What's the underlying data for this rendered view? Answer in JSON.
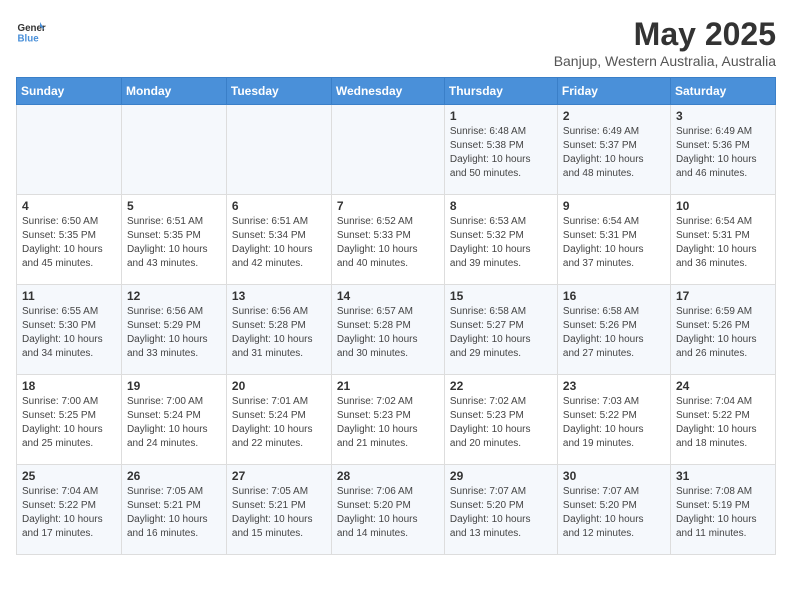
{
  "logo": {
    "line1": "General",
    "line2": "Blue"
  },
  "title": "May 2025",
  "subtitle": "Banjup, Western Australia, Australia",
  "headers": [
    "Sunday",
    "Monday",
    "Tuesday",
    "Wednesday",
    "Thursday",
    "Friday",
    "Saturday"
  ],
  "weeks": [
    [
      {
        "day": "",
        "info": ""
      },
      {
        "day": "",
        "info": ""
      },
      {
        "day": "",
        "info": ""
      },
      {
        "day": "",
        "info": ""
      },
      {
        "day": "1",
        "info": "Sunrise: 6:48 AM\nSunset: 5:38 PM\nDaylight: 10 hours\nand 50 minutes."
      },
      {
        "day": "2",
        "info": "Sunrise: 6:49 AM\nSunset: 5:37 PM\nDaylight: 10 hours\nand 48 minutes."
      },
      {
        "day": "3",
        "info": "Sunrise: 6:49 AM\nSunset: 5:36 PM\nDaylight: 10 hours\nand 46 minutes."
      }
    ],
    [
      {
        "day": "4",
        "info": "Sunrise: 6:50 AM\nSunset: 5:35 PM\nDaylight: 10 hours\nand 45 minutes."
      },
      {
        "day": "5",
        "info": "Sunrise: 6:51 AM\nSunset: 5:35 PM\nDaylight: 10 hours\nand 43 minutes."
      },
      {
        "day": "6",
        "info": "Sunrise: 6:51 AM\nSunset: 5:34 PM\nDaylight: 10 hours\nand 42 minutes."
      },
      {
        "day": "7",
        "info": "Sunrise: 6:52 AM\nSunset: 5:33 PM\nDaylight: 10 hours\nand 40 minutes."
      },
      {
        "day": "8",
        "info": "Sunrise: 6:53 AM\nSunset: 5:32 PM\nDaylight: 10 hours\nand 39 minutes."
      },
      {
        "day": "9",
        "info": "Sunrise: 6:54 AM\nSunset: 5:31 PM\nDaylight: 10 hours\nand 37 minutes."
      },
      {
        "day": "10",
        "info": "Sunrise: 6:54 AM\nSunset: 5:31 PM\nDaylight: 10 hours\nand 36 minutes."
      }
    ],
    [
      {
        "day": "11",
        "info": "Sunrise: 6:55 AM\nSunset: 5:30 PM\nDaylight: 10 hours\nand 34 minutes."
      },
      {
        "day": "12",
        "info": "Sunrise: 6:56 AM\nSunset: 5:29 PM\nDaylight: 10 hours\nand 33 minutes."
      },
      {
        "day": "13",
        "info": "Sunrise: 6:56 AM\nSunset: 5:28 PM\nDaylight: 10 hours\nand 31 minutes."
      },
      {
        "day": "14",
        "info": "Sunrise: 6:57 AM\nSunset: 5:28 PM\nDaylight: 10 hours\nand 30 minutes."
      },
      {
        "day": "15",
        "info": "Sunrise: 6:58 AM\nSunset: 5:27 PM\nDaylight: 10 hours\nand 29 minutes."
      },
      {
        "day": "16",
        "info": "Sunrise: 6:58 AM\nSunset: 5:26 PM\nDaylight: 10 hours\nand 27 minutes."
      },
      {
        "day": "17",
        "info": "Sunrise: 6:59 AM\nSunset: 5:26 PM\nDaylight: 10 hours\nand 26 minutes."
      }
    ],
    [
      {
        "day": "18",
        "info": "Sunrise: 7:00 AM\nSunset: 5:25 PM\nDaylight: 10 hours\nand 25 minutes."
      },
      {
        "day": "19",
        "info": "Sunrise: 7:00 AM\nSunset: 5:24 PM\nDaylight: 10 hours\nand 24 minutes."
      },
      {
        "day": "20",
        "info": "Sunrise: 7:01 AM\nSunset: 5:24 PM\nDaylight: 10 hours\nand 22 minutes."
      },
      {
        "day": "21",
        "info": "Sunrise: 7:02 AM\nSunset: 5:23 PM\nDaylight: 10 hours\nand 21 minutes."
      },
      {
        "day": "22",
        "info": "Sunrise: 7:02 AM\nSunset: 5:23 PM\nDaylight: 10 hours\nand 20 minutes."
      },
      {
        "day": "23",
        "info": "Sunrise: 7:03 AM\nSunset: 5:22 PM\nDaylight: 10 hours\nand 19 minutes."
      },
      {
        "day": "24",
        "info": "Sunrise: 7:04 AM\nSunset: 5:22 PM\nDaylight: 10 hours\nand 18 minutes."
      }
    ],
    [
      {
        "day": "25",
        "info": "Sunrise: 7:04 AM\nSunset: 5:22 PM\nDaylight: 10 hours\nand 17 minutes."
      },
      {
        "day": "26",
        "info": "Sunrise: 7:05 AM\nSunset: 5:21 PM\nDaylight: 10 hours\nand 16 minutes."
      },
      {
        "day": "27",
        "info": "Sunrise: 7:05 AM\nSunset: 5:21 PM\nDaylight: 10 hours\nand 15 minutes."
      },
      {
        "day": "28",
        "info": "Sunrise: 7:06 AM\nSunset: 5:20 PM\nDaylight: 10 hours\nand 14 minutes."
      },
      {
        "day": "29",
        "info": "Sunrise: 7:07 AM\nSunset: 5:20 PM\nDaylight: 10 hours\nand 13 minutes."
      },
      {
        "day": "30",
        "info": "Sunrise: 7:07 AM\nSunset: 5:20 PM\nDaylight: 10 hours\nand 12 minutes."
      },
      {
        "day": "31",
        "info": "Sunrise: 7:08 AM\nSunset: 5:19 PM\nDaylight: 10 hours\nand 11 minutes."
      }
    ]
  ]
}
